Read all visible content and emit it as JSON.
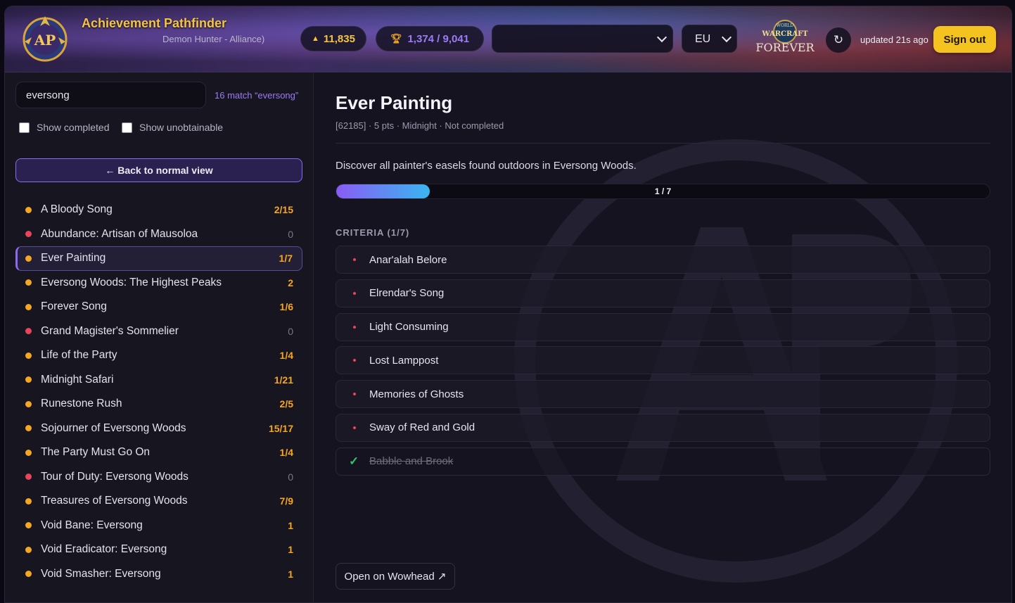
{
  "header": {
    "app_title": "Achievement Pathfinder",
    "character_subtitle": "Demon Hunter - Alliance)",
    "points": "11,835",
    "achievements": "1,374 / 9,041",
    "character_select_value": "",
    "region": "EU",
    "updated_text": "updated 21s ago",
    "sign_out_label": "Sign out",
    "refresh_symbol": "↻",
    "wow_logo_line1": "WORLD",
    "wow_logo_line2": "WARCRAFT",
    "wow_logo_line3": "FOREVER",
    "logo_text": "AP"
  },
  "sidebar": {
    "search_value": "eversong",
    "match_text": "16 match “eversong”",
    "show_completed_label": "Show completed",
    "show_unobtainable_label": "Show unobtainable",
    "back_label": "← Back to normal view",
    "items": [
      {
        "name": "A Bloody Song",
        "count": "2/15",
        "status": "progress"
      },
      {
        "name": "Abundance: Artisan of Mausoloa",
        "count": "0",
        "status": "none"
      },
      {
        "name": "Ever Painting",
        "count": "1/7",
        "status": "progress",
        "active": true
      },
      {
        "name": "Eversong Woods: The Highest Peaks",
        "count": "2",
        "status": "progress"
      },
      {
        "name": "Forever Song",
        "count": "1/6",
        "status": "progress"
      },
      {
        "name": "Grand Magister's Sommelier",
        "count": "0",
        "status": "none"
      },
      {
        "name": "Life of the Party",
        "count": "1/4",
        "status": "progress"
      },
      {
        "name": "Midnight Safari",
        "count": "1/21",
        "status": "progress"
      },
      {
        "name": "Runestone Rush",
        "count": "2/5",
        "status": "progress"
      },
      {
        "name": "Sojourner of Eversong Woods",
        "count": "15/17",
        "status": "progress"
      },
      {
        "name": "The Party Must Go On",
        "count": "1/4",
        "status": "progress"
      },
      {
        "name": "Tour of Duty: Eversong Woods",
        "count": "0",
        "status": "none"
      },
      {
        "name": "Treasures of Eversong Woods",
        "count": "7/9",
        "status": "progress"
      },
      {
        "name": "Void Bane: Eversong",
        "count": "1",
        "status": "progress"
      },
      {
        "name": "Void Eradicator: Eversong",
        "count": "1",
        "status": "progress"
      },
      {
        "name": "Void Smasher: Eversong",
        "count": "1",
        "status": "progress"
      }
    ]
  },
  "main": {
    "title": "Ever Painting",
    "meta": "[62185] · 5 pts · Midnight · Not completed",
    "description": "Discover all painter's easels found outdoors in Eversong Woods.",
    "progress_label": "1 / 7",
    "progress_fraction": 0.1429,
    "criteria_heading": "CRITERIA (1/7)",
    "criteria": [
      {
        "name": "Anar'alah Belore",
        "done": false
      },
      {
        "name": "Elrendar's Song",
        "done": false
      },
      {
        "name": "Light Consuming",
        "done": false
      },
      {
        "name": "Lost Lamppost",
        "done": false
      },
      {
        "name": "Memories of Ghosts",
        "done": false
      },
      {
        "name": "Sway of Red and Gold",
        "done": false
      },
      {
        "name": "Babble and Brook",
        "done": true
      }
    ],
    "wowhead_label": "Open on Wowhead ↗"
  },
  "colors": {
    "accent": "#8a6cf0",
    "gold": "#f5c542",
    "progress_dot": "#f5a623",
    "none_dot": "#e8455a",
    "done_check": "#32c26a"
  }
}
